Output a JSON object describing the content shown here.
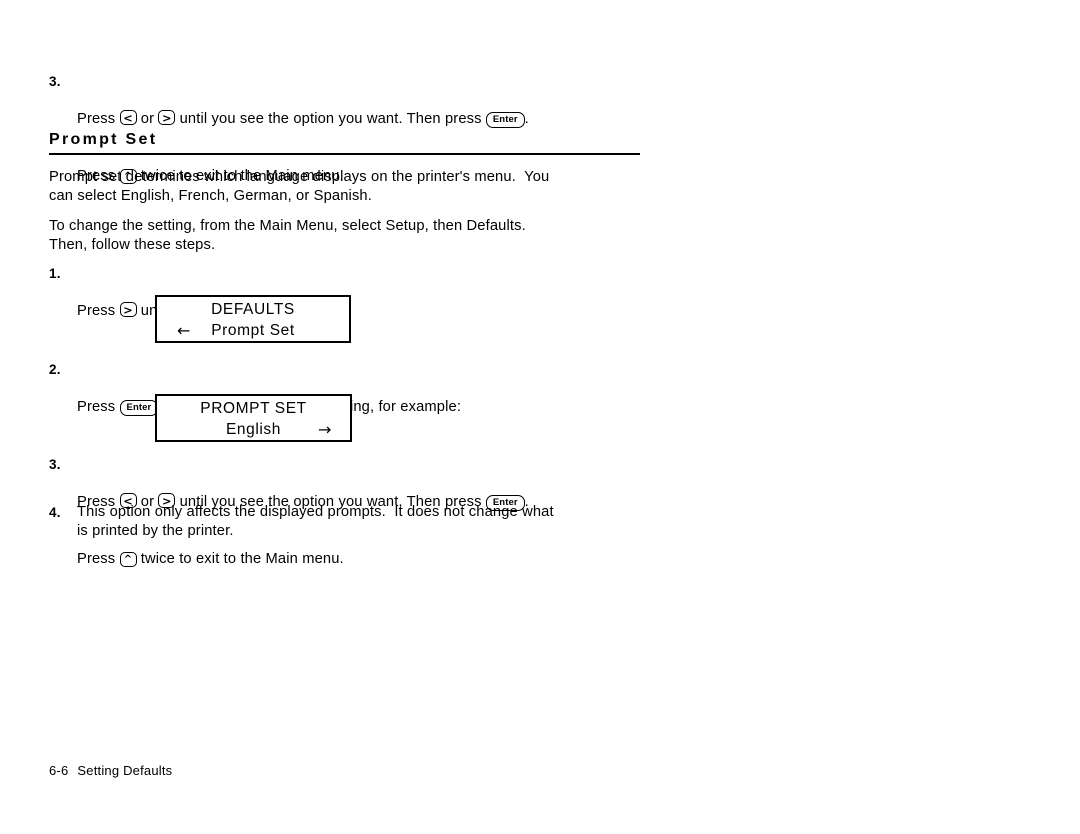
{
  "page": {
    "background": "#ffffff",
    "text_color": "#000000"
  },
  "top_step": {
    "number": "3.",
    "line1_before_key1": "Press ",
    "key1": "<",
    "line1_mid": " or ",
    "key2": ">",
    "line1_after_key2": " until you see the option you want.  Then press ",
    "key_enter": "Enter",
    "line1_end": ".",
    "line2_before_key": "Press ",
    "key_up": "^",
    "line2_after_key": " twice to exit to the Main menu."
  },
  "heading": {
    "title": "Prompt Set"
  },
  "intro": {
    "paragraph1": "Prompt set determines which language displays on the printer's menu.  You\ncan select English, French, German, or Spanish.",
    "paragraph2": "To change the setting, from the Main Menu, select Setup, then Defaults.\nThen, follow these steps."
  },
  "steps": [
    {
      "number": "1.",
      "before_key": "Press ",
      "key": ">",
      "after_key": " until you see"
    },
    {
      "number": "2.",
      "before_key": "Press ",
      "key_enter": "Enter",
      "after_key": ".  You will see the current setting, for example:"
    },
    {
      "number": "3.",
      "line1_before_key1": "Press ",
      "key1": "<",
      "line1_mid": " or ",
      "key2": ">",
      "line1_after_key2": " until you see the option you want.  Then press ",
      "key_enter": "Enter",
      "line1_end": ".",
      "line2_before_key": "Press ",
      "key_up": "^",
      "line2_after_key": " twice to exit to the Main menu."
    },
    {
      "number": "4.",
      "text": "This option only affects the displayed prompts.  It does not change what\nis printed by the printer."
    }
  ],
  "display_boxes": [
    {
      "line1": "DEFAULTS",
      "arrow_left": "←",
      "line2": "Prompt Set"
    },
    {
      "line1": "PROMPT SET",
      "line2": "English",
      "arrow_right": "→"
    }
  ],
  "footer": {
    "folio": "6-6",
    "section": "Setting Defaults"
  }
}
